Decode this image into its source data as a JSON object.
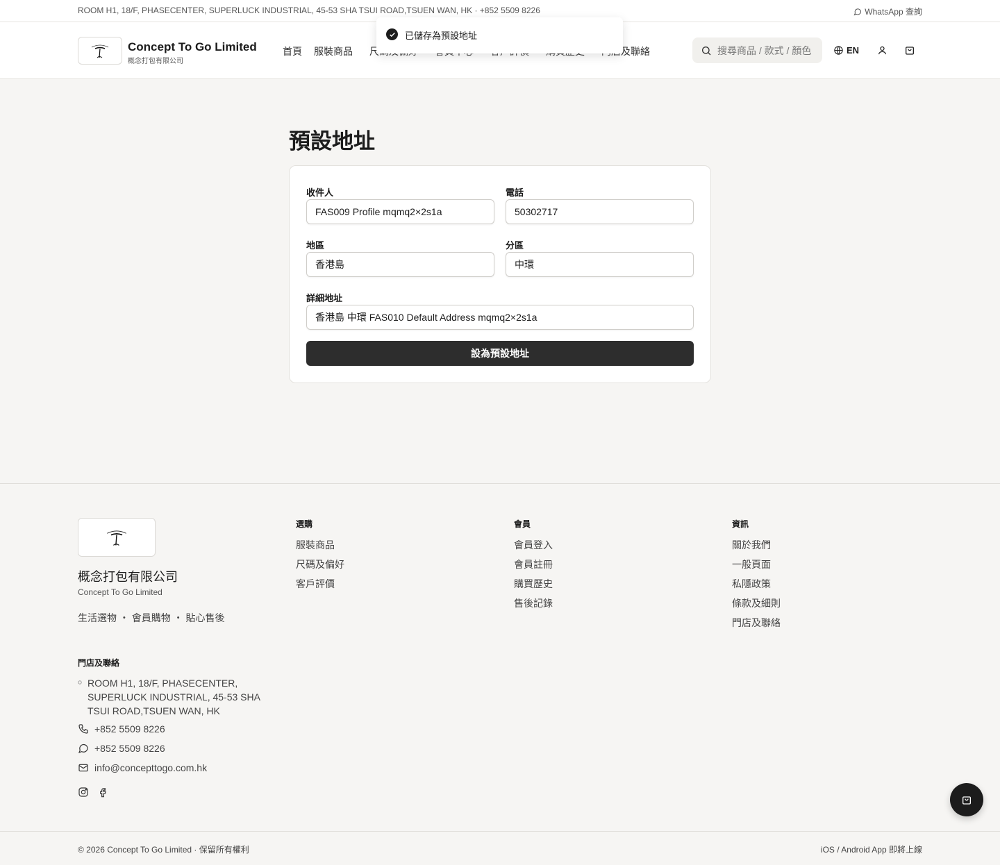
{
  "topbar": {
    "address": "ROOM H1, 18/F, PHASECENTER, SUPERLUCK INDUSTRIAL, 45-53 SHA TSUI ROAD,TSUEN WAN, HK · +852 5509 8226",
    "whatsapp": "WhatsApp 查詢"
  },
  "header": {
    "brand_name": "Concept To Go Limited",
    "brand_sub": "概念打包有限公司",
    "nav": [
      "首頁",
      "服裝商品",
      "尺碼及偏好",
      "會員中心",
      "客戶評價",
      "購買歷史",
      "門店及聯絡"
    ],
    "search_placeholder": "搜尋商品 / 款式 / 顏色",
    "lang": "EN",
    "icons": {
      "search": "search-icon",
      "globe": "globe-icon",
      "user": "user-icon",
      "cart": "shopping-bag-icon"
    }
  },
  "toast": {
    "message": "已儲存為預設地址"
  },
  "main": {
    "title": "預設地址",
    "form": {
      "recipient_label": "收件人",
      "recipient_value": "FAS009 Profile mqmq2×2s1a",
      "phone_label": "電話",
      "phone_value": "50302717",
      "region_label": "地區",
      "region_value": "香港島",
      "district_label": "分區",
      "district_value": "中環",
      "address_label": "詳細地址",
      "address_value": "香港島 中環 FAS010 Default Address mqmq2×2s1a",
      "submit_label": "設為預設地址"
    }
  },
  "footer": {
    "company_zh": "概念打包有限公司",
    "company_en": "Concept To Go Limited",
    "tagline": "生活選物 ・ 會員購物 ・ 貼心售後",
    "columns": [
      {
        "title": "選購",
        "links": [
          "服裝商品",
          "尺碼及偏好",
          "客戶評價"
        ]
      },
      {
        "title": "會員",
        "links": [
          "會員登入",
          "會員註冊",
          "購買歷史",
          "售後記錄"
        ]
      },
      {
        "title": "資訊",
        "links": [
          "關於我們",
          "一般頁面",
          "私隱政策",
          "條款及細則",
          "門店及聯絡"
        ]
      }
    ],
    "contact_title": "門店及聯絡",
    "contact_address": "ROOM H1, 18/F, PHASECENTER, SUPERLUCK INDUSTRIAL, 45-53 SHA TSUI ROAD,TSUEN WAN, HK",
    "phone": "+852 5509 8226",
    "whatsapp": "+852 5509 8226",
    "email": "info@concepttogo.com.hk"
  },
  "bottom": {
    "copyright": "© 2026 Concept To Go Limited · 保留所有權利",
    "app_note": "iOS / Android App 即將上線"
  },
  "colors": {
    "primary": "#2d2d2d",
    "background": "#f6f5f3",
    "surface": "#ffffff"
  }
}
